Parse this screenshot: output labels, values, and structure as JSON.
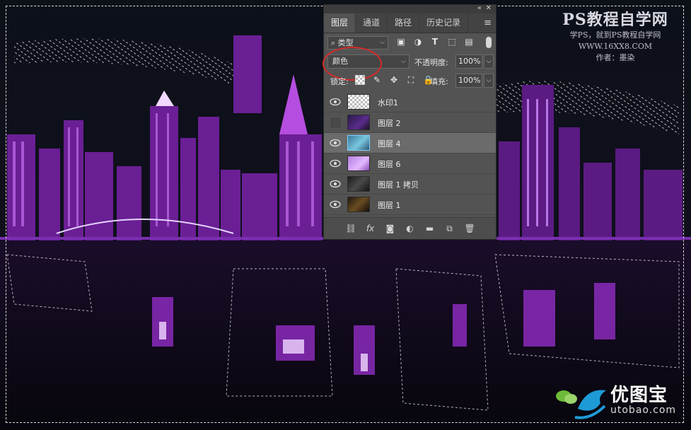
{
  "watermark": {
    "title": "PS教程自学网",
    "line1": "学PS，就到PS教程自学网",
    "line2": "WWW.16XX8.COM",
    "line3": "作者：墨染"
  },
  "panel": {
    "tabs": [
      "图层",
      "通道",
      "路径",
      "历史记录"
    ],
    "active_tab": "图层",
    "filter_kind": "类型",
    "blend_mode": "颜色",
    "opacity_label": "不透明度:",
    "opacity_value": "100%",
    "lock_label": "锁定:",
    "fill_label": "填充:",
    "fill_value": "100%",
    "layers": [
      {
        "name": "水印1",
        "visible": true
      },
      {
        "name": "图层 2",
        "visible": false
      },
      {
        "name": "图层 4",
        "visible": true,
        "selected": true
      },
      {
        "name": "图层 6",
        "visible": true
      },
      {
        "name": "图层 1 拷贝",
        "visible": true
      },
      {
        "name": "图层 1",
        "visible": true
      }
    ]
  },
  "logo": {
    "title": "优图宝",
    "url": "utobao.com"
  },
  "colors": {
    "highlight_circle": "#d52a2a",
    "city_purple": "#9b2fd1",
    "background": "#0b0a16"
  }
}
